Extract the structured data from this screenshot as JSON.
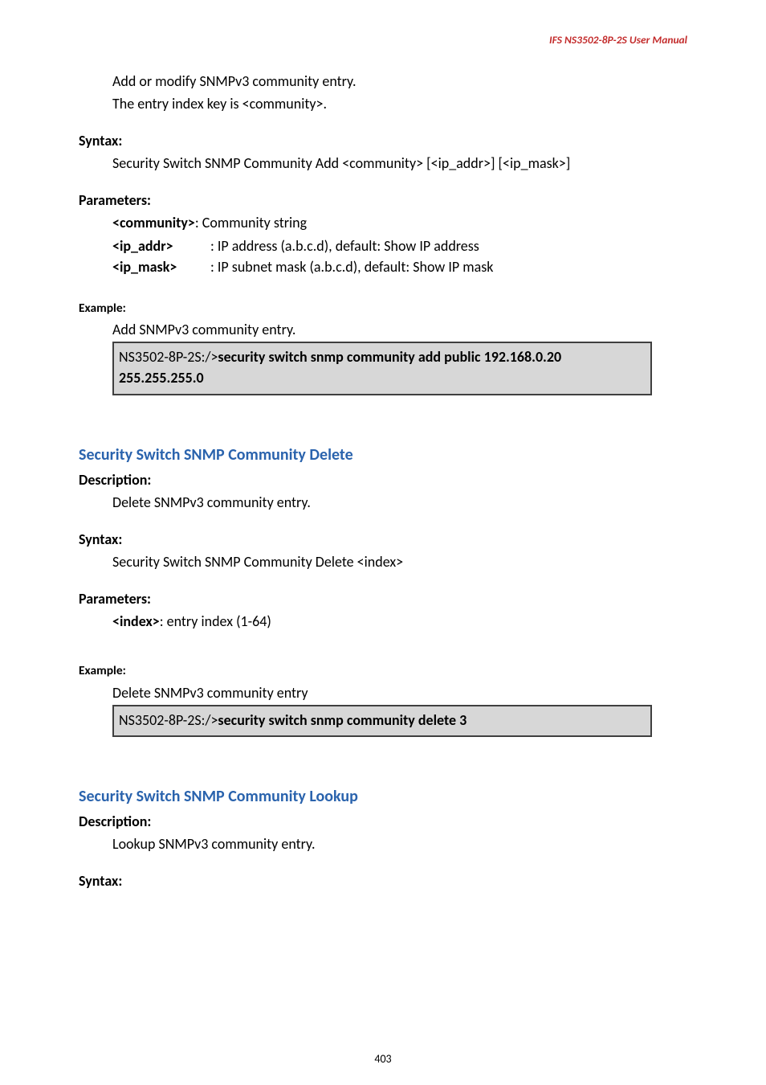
{
  "header": {
    "product_line": "IFS  NS3502-8P-2S  User  Manual"
  },
  "sec_add": {
    "desc_line1": "Add or modify SNMPv3 community entry.",
    "desc_line2": "The entry index key is <community>.",
    "syntax_label": "Syntax:",
    "syntax_text": "Security Switch SNMP Community Add <community> [<ip_addr>] [<ip_mask>]",
    "params_label": "Parameters:",
    "param_community_key": "<community>",
    "param_community_val": ": Community string",
    "param_ipaddr_key": "<ip_addr>",
    "param_ipaddr_val": ": IP address (a.b.c.d), default: Show IP address",
    "param_ipmask_key": "<ip_mask>",
    "param_ipmask_val": ": IP subnet mask (a.b.c.d), default: Show IP mask",
    "example_label": "Example:",
    "example_caption": "Add SNMPv3 community entry.",
    "example_prompt": "NS3502-8P-2S:/>",
    "example_cmd_line1": "security switch snmp community add public 192.168.0.20",
    "example_cmd_line2": "255.255.255.0"
  },
  "sec_delete": {
    "title": "Security Switch SNMP Community Delete",
    "desc_label": "Description:",
    "desc_text": "Delete SNMPv3 community entry.",
    "syntax_label": "Syntax:",
    "syntax_text": "Security Switch SNMP Community Delete <index>",
    "params_label": "Parameters:",
    "param_index_key": "<index>",
    "param_index_val": ": entry index (1-64)",
    "example_label": "Example:",
    "example_caption": "Delete SNMPv3 community entry",
    "example_prompt": "NS3502-8P-2S:/>",
    "example_cmd": "security switch snmp community delete 3"
  },
  "sec_lookup": {
    "title": "Security Switch SNMP Community Lookup",
    "desc_label": "Description:",
    "desc_text": "Lookup SNMPv3 community entry.",
    "syntax_label": "Syntax:"
  },
  "footer": {
    "page_number": "403"
  }
}
